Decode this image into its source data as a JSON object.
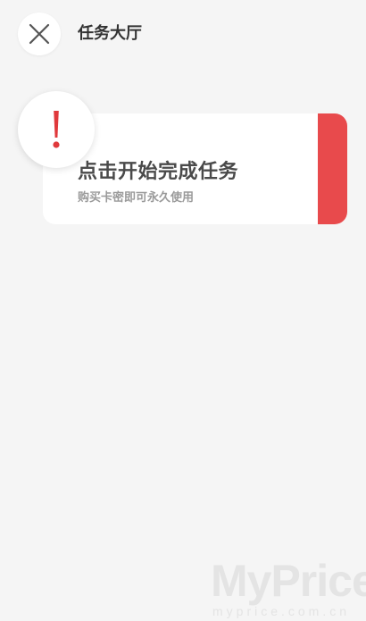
{
  "header": {
    "title": "任务大厅",
    "close_icon": "close-icon"
  },
  "task_card": {
    "title": "点击开始完成任务",
    "subtitle": "购买卡密即可永久使用",
    "alert_icon": "exclamation-icon"
  },
  "watermark": {
    "brand": "MyPrice",
    "domain": "myprice.com.cn"
  },
  "colors": {
    "background": "#f5f5f5",
    "accent": "#e84a4c",
    "alert": "#e0393c",
    "text_dark": "#333333",
    "text_muted": "#9a9a9a"
  }
}
